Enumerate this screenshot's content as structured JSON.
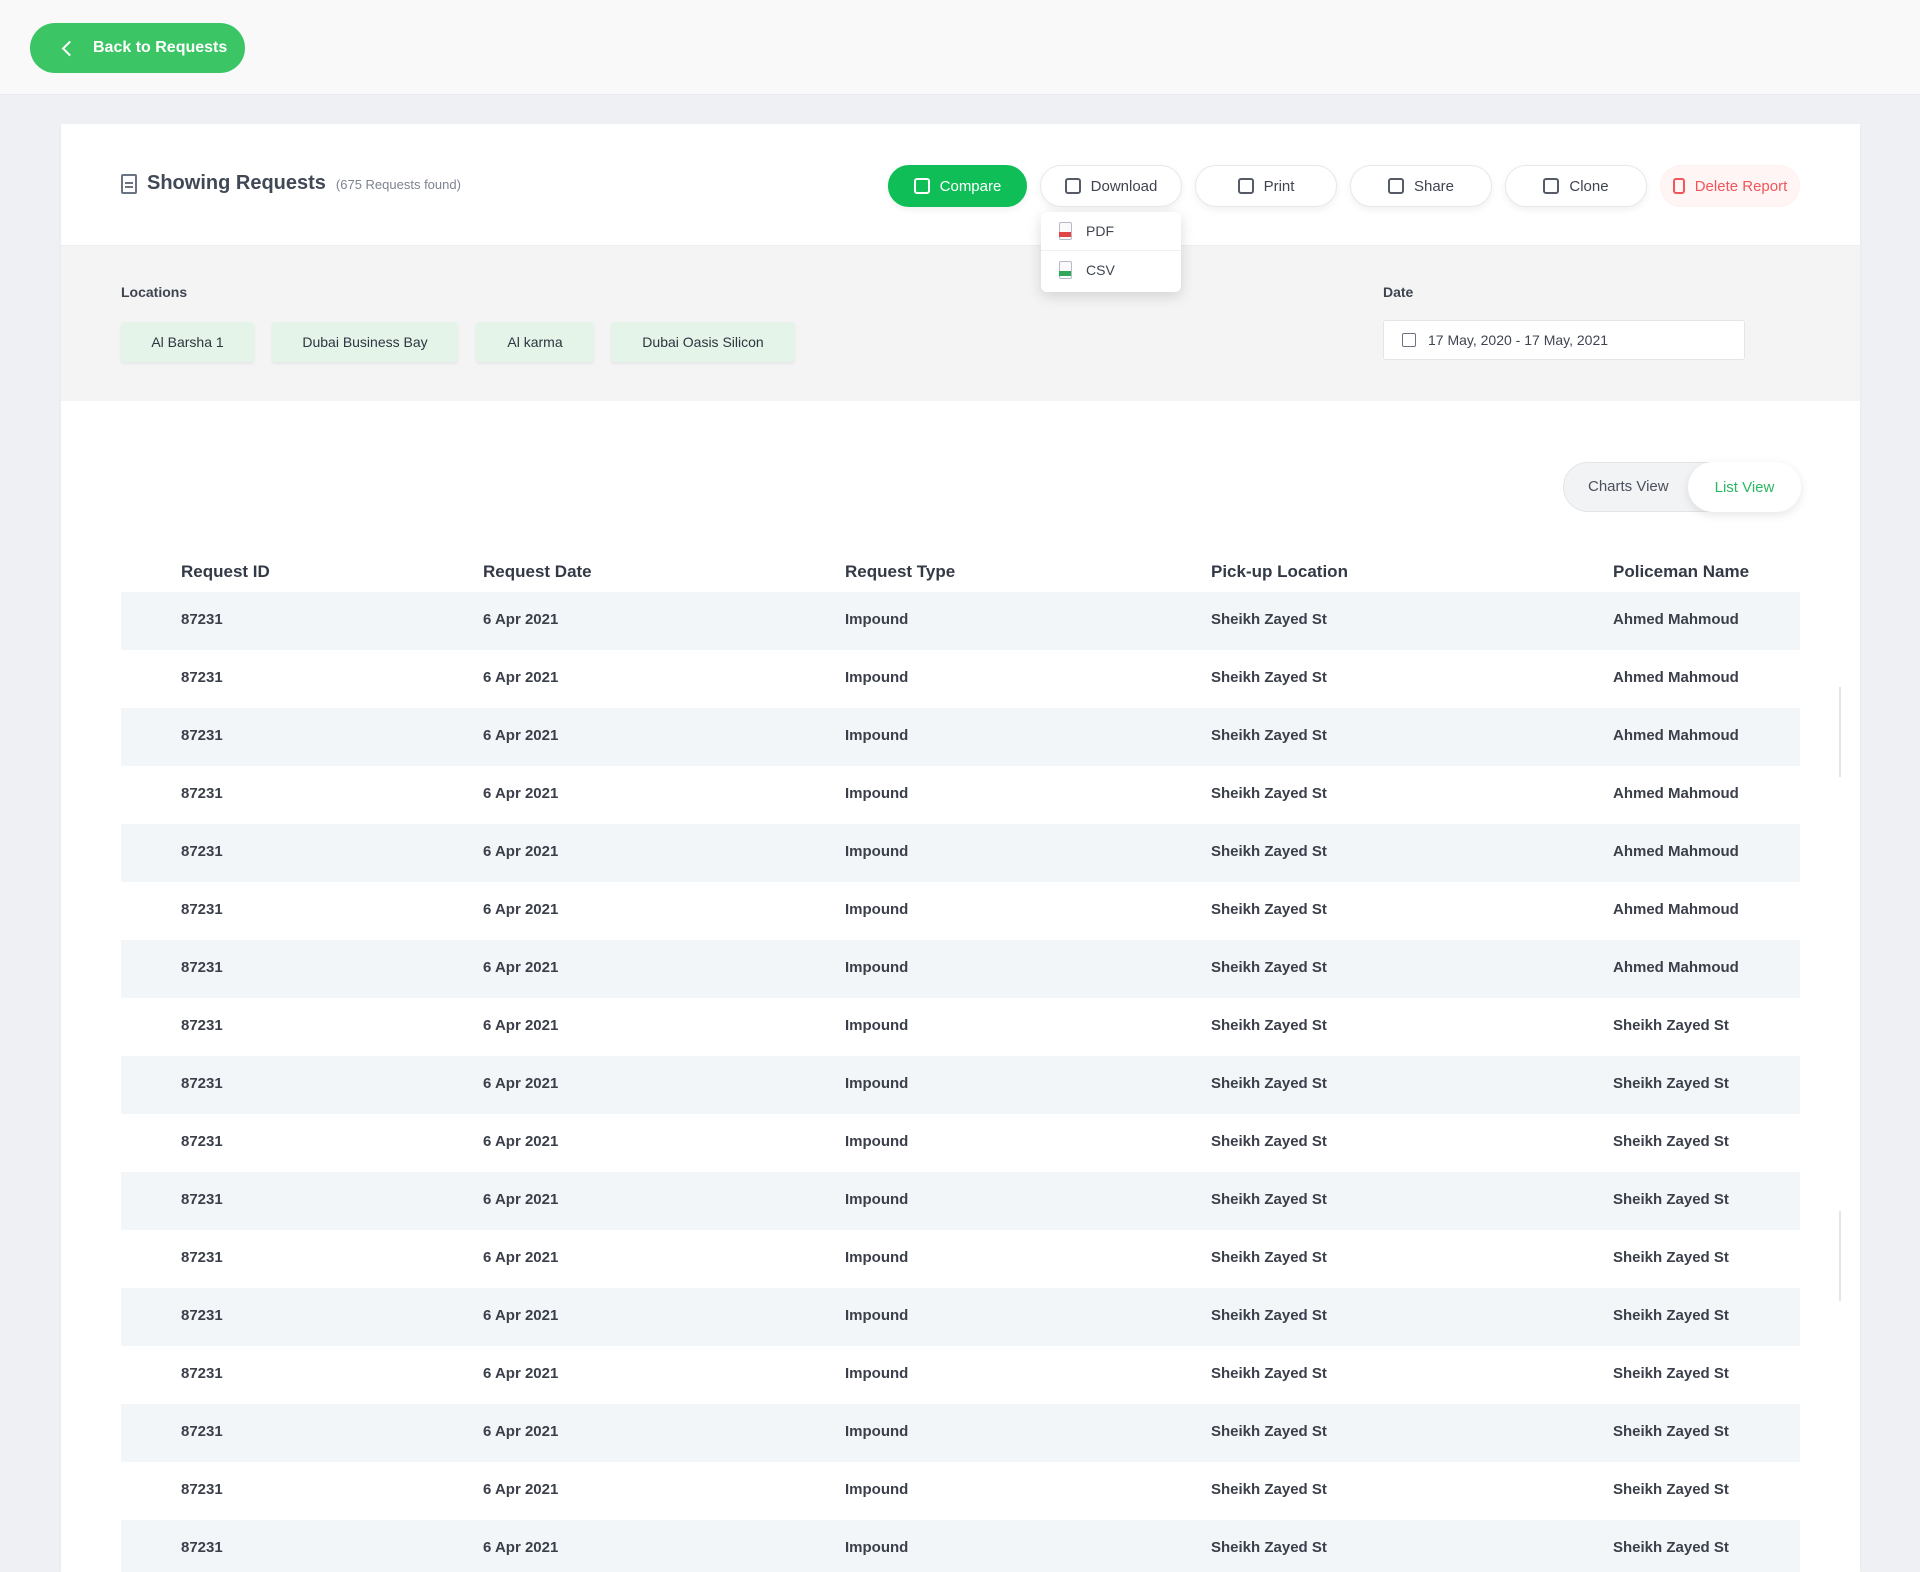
{
  "topbar": {
    "back_label": "Back to Requests"
  },
  "header": {
    "title": "Showing Requests",
    "count": "(675 Requests found)",
    "actions": {
      "compare": "Compare",
      "download": "Download",
      "print": "Print",
      "share": "Share",
      "clone": "Clone",
      "delete": "Delete Report"
    },
    "download_menu": [
      "PDF",
      "CSV"
    ]
  },
  "filters": {
    "locations_label": "Locations",
    "locations": [
      "Al Barsha 1",
      "Dubai Business Bay",
      "Al karma",
      "Dubai Oasis Silicon"
    ],
    "date_label": "Date",
    "date_range": "17 May, 2020 - 17 May, 2021"
  },
  "view_toggle": {
    "charts": "Charts View",
    "list": "List View",
    "active": "List View"
  },
  "colors": {
    "accent": "#0fbe57",
    "danger": "#f0565a",
    "chip_bg": "#e4f4e9"
  },
  "table": {
    "headers": [
      "Request ID",
      "Request Date",
      "Request Type",
      "Pick-up Location",
      "Policeman Name"
    ],
    "rows": [
      [
        "87231",
        "6 Apr 2021",
        "Impound",
        "Sheikh Zayed St",
        "Ahmed Mahmoud"
      ],
      [
        "87231",
        "6 Apr 2021",
        "Impound",
        "Sheikh Zayed St",
        "Ahmed Mahmoud"
      ],
      [
        "87231",
        "6 Apr 2021",
        "Impound",
        "Sheikh Zayed St",
        "Ahmed Mahmoud"
      ],
      [
        "87231",
        "6 Apr 2021",
        "Impound",
        "Sheikh Zayed St",
        "Ahmed Mahmoud"
      ],
      [
        "87231",
        "6 Apr 2021",
        "Impound",
        "Sheikh Zayed St",
        "Ahmed Mahmoud"
      ],
      [
        "87231",
        "6 Apr 2021",
        "Impound",
        "Sheikh Zayed St",
        "Ahmed Mahmoud"
      ],
      [
        "87231",
        "6 Apr 2021",
        "Impound",
        "Sheikh Zayed St",
        "Ahmed Mahmoud"
      ],
      [
        "87231",
        "6 Apr 2021",
        "Impound",
        "Sheikh Zayed St",
        "Sheikh Zayed St"
      ],
      [
        "87231",
        "6 Apr 2021",
        "Impound",
        "Sheikh Zayed St",
        "Sheikh Zayed St"
      ],
      [
        "87231",
        "6 Apr 2021",
        "Impound",
        "Sheikh Zayed St",
        "Sheikh Zayed St"
      ],
      [
        "87231",
        "6 Apr 2021",
        "Impound",
        "Sheikh Zayed St",
        "Sheikh Zayed St"
      ],
      [
        "87231",
        "6 Apr 2021",
        "Impound",
        "Sheikh Zayed St",
        "Sheikh Zayed St"
      ],
      [
        "87231",
        "6 Apr 2021",
        "Impound",
        "Sheikh Zayed St",
        "Sheikh Zayed St"
      ],
      [
        "87231",
        "6 Apr 2021",
        "Impound",
        "Sheikh Zayed St",
        "Sheikh Zayed St"
      ],
      [
        "87231",
        "6 Apr 2021",
        "Impound",
        "Sheikh Zayed St",
        "Sheikh Zayed St"
      ],
      [
        "87231",
        "6 Apr 2021",
        "Impound",
        "Sheikh Zayed St",
        "Sheikh Zayed St"
      ],
      [
        "87231",
        "6 Apr 2021",
        "Impound",
        "Sheikh Zayed St",
        "Sheikh Zayed St"
      ]
    ]
  }
}
